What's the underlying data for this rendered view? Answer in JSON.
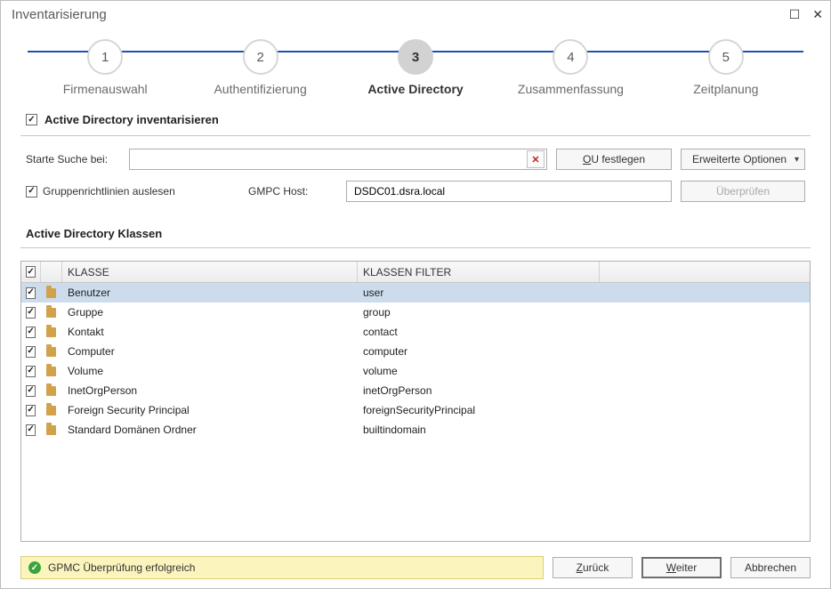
{
  "window": {
    "title": "Inventarisierung"
  },
  "steps": [
    {
      "num": "1",
      "label": "Firmenauswahl",
      "active": false
    },
    {
      "num": "2",
      "label": "Authentifizierung",
      "active": false
    },
    {
      "num": "3",
      "label": "Active Directory",
      "active": true
    },
    {
      "num": "4",
      "label": "Zusammenfassung",
      "active": false
    },
    {
      "num": "5",
      "label": "Zeitplanung",
      "active": false
    }
  ],
  "section": {
    "inventory_checkbox_label": "Active Directory inventarisieren",
    "inventory_checked": true
  },
  "search": {
    "label": "Starte Suche bei:",
    "value": "",
    "ou_button_prefix": "O",
    "ou_button_rest": "U festlegen",
    "options_label": "Erweiterte Optionen"
  },
  "gp": {
    "read_checked": true,
    "read_label": "Gruppenrichtlinien auslesen",
    "host_label": "GMPC Host:",
    "host_value": "DSDC01.dsra.local",
    "verify_label": "Überprüfen"
  },
  "classes_title": "Active Directory Klassen",
  "table": {
    "headers": {
      "klass": "KLASSE",
      "filter": "KLASSEN FILTER"
    },
    "rows": [
      {
        "checked": true,
        "name": "Benutzer",
        "filter": "user",
        "selected": true
      },
      {
        "checked": true,
        "name": "Gruppe",
        "filter": "group",
        "selected": false
      },
      {
        "checked": true,
        "name": "Kontakt",
        "filter": "contact",
        "selected": false
      },
      {
        "checked": true,
        "name": "Computer",
        "filter": "computer",
        "selected": false
      },
      {
        "checked": true,
        "name": "Volume",
        "filter": "volume",
        "selected": false
      },
      {
        "checked": true,
        "name": "InetOrgPerson",
        "filter": "inetOrgPerson",
        "selected": false
      },
      {
        "checked": true,
        "name": "Foreign Security Principal",
        "filter": "foreignSecurityPrincipal",
        "selected": false
      },
      {
        "checked": true,
        "name": "Standard Domänen Ordner",
        "filter": "builtindomain",
        "selected": false
      }
    ]
  },
  "status": {
    "text": "GPMC Überprüfung erfolgreich"
  },
  "footer": {
    "back_prefix": "Z",
    "back_rest": "urück",
    "next_prefix": "W",
    "next_rest": "eiter",
    "cancel": "Abbrechen"
  }
}
